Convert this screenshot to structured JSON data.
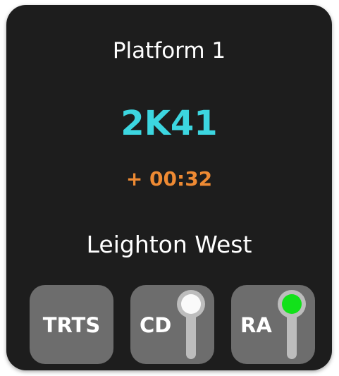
{
  "platform": {
    "label": "Platform 1"
  },
  "train": {
    "headcode": "2K41",
    "delay": "+ 00:32",
    "destination": "Leighton West"
  },
  "buttons": [
    {
      "label": "TRTS"
    },
    {
      "label": "CD",
      "indicator": "white"
    },
    {
      "label": "RA",
      "indicator": "green"
    }
  ],
  "colors": {
    "card_background": "#1d1d1d",
    "headcode": "#3cd6e0",
    "delay": "#ee8a33",
    "button_background": "#6d6d6d",
    "indicator_white": "#fafafa",
    "indicator_green": "#12e11a",
    "indicator_stem": "#bdbdbd"
  }
}
